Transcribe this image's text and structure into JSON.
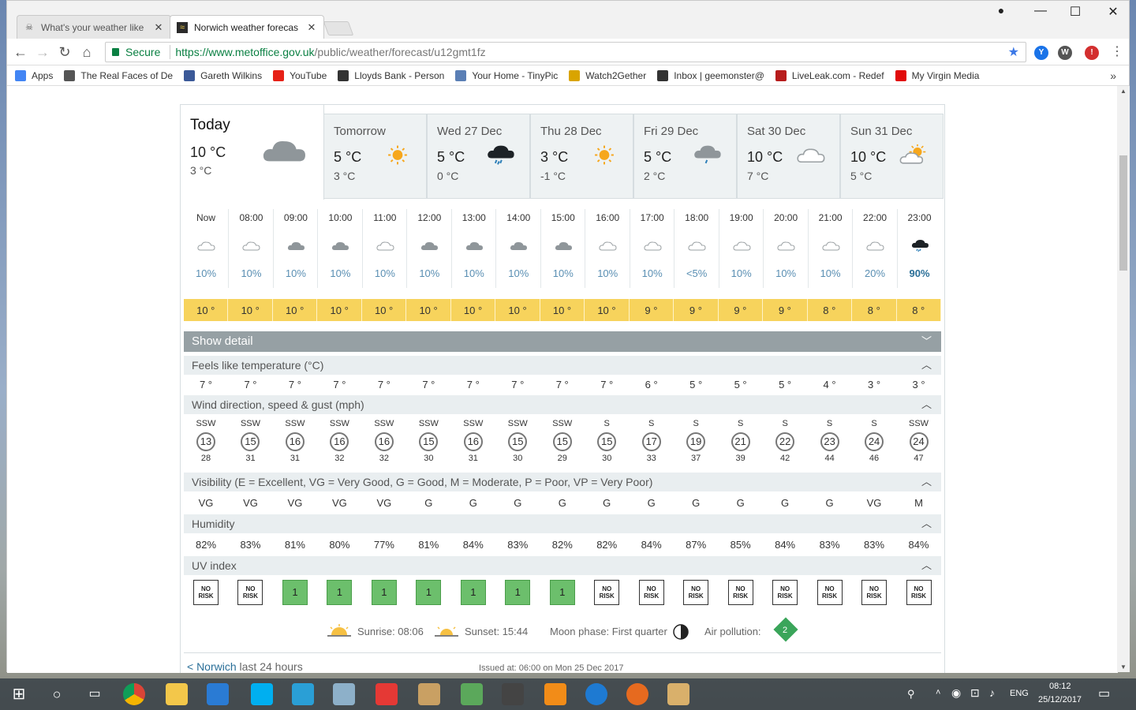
{
  "browser": {
    "tabs": [
      {
        "title": "What's your weather like",
        "active": false
      },
      {
        "title": "Norwich weather forecas",
        "active": true
      }
    ],
    "secure_label": "Secure",
    "url_host": "https://www.metoffice.gov.uk",
    "url_path": "/public/weather/forecast/u12gmt1fz",
    "bookmarks": [
      {
        "label": "Apps",
        "icon": "apps-grid-icon",
        "color": "#4285f4"
      },
      {
        "label": "The Real Faces of De",
        "icon": "skull-icon",
        "color": "#555555"
      },
      {
        "label": "Gareth Wilkins",
        "icon": "facebook-icon",
        "color": "#3b5998"
      },
      {
        "label": "YouTube",
        "icon": "youtube-icon",
        "color": "#e62117"
      },
      {
        "label": "Lloyds Bank - Person",
        "icon": "horse-icon",
        "color": "#333333"
      },
      {
        "label": "Your Home - TinyPic",
        "icon": "tinypic-icon",
        "color": "#5a7fb5"
      },
      {
        "label": "Watch2Gether",
        "icon": "watch2gether-icon",
        "color": "#d9a400"
      },
      {
        "label": "Inbox | geemonster@",
        "icon": "inbox-icon",
        "color": "#333333"
      },
      {
        "label": "LiveLeak.com - Redef",
        "icon": "liveleak-icon",
        "color": "#b71c1c"
      },
      {
        "label": "My Virgin Media",
        "icon": "virgin-icon",
        "color": "#e10a0a"
      }
    ]
  },
  "forecast": {
    "days": [
      {
        "name": "Today",
        "max": "10 °C",
        "min": "3 °C",
        "icon": "cloudy-icon"
      },
      {
        "name": "Tomorrow",
        "max": "5 °C",
        "min": "3 °C",
        "icon": "sunny-icon"
      },
      {
        "name": "Wed 27 Dec",
        "max": "5 °C",
        "min": "0 °C",
        "icon": "heavy-rain-icon"
      },
      {
        "name": "Thu 28 Dec",
        "max": "3 °C",
        "min": "-1 °C",
        "icon": "sunny-icon"
      },
      {
        "name": "Fri 29 Dec",
        "max": "5 °C",
        "min": "2 °C",
        "icon": "light-rain-icon"
      },
      {
        "name": "Sat 30 Dec",
        "max": "10 °C",
        "min": "7 °C",
        "icon": "cloud-outline-icon"
      },
      {
        "name": "Sun 31 Dec",
        "max": "10 °C",
        "min": "5 °C",
        "icon": "sunny-intervals-icon"
      }
    ],
    "hours": [
      "Now",
      "08:00",
      "09:00",
      "10:00",
      "11:00",
      "12:00",
      "13:00",
      "14:00",
      "15:00",
      "16:00",
      "17:00",
      "18:00",
      "19:00",
      "20:00",
      "21:00",
      "22:00",
      "23:00"
    ],
    "hour_icons": [
      "cloud-outline-icon",
      "cloud-outline-icon",
      "cloudy-icon",
      "cloudy-icon",
      "cloud-outline-icon",
      "cloudy-icon",
      "cloudy-icon",
      "cloudy-icon",
      "cloudy-icon",
      "cloud-outline-icon",
      "cloud-outline-icon",
      "cloud-outline-icon",
      "cloud-outline-icon",
      "cloud-outline-icon",
      "cloud-outline-icon",
      "cloud-outline-icon",
      "heavy-rain-icon"
    ],
    "precip": [
      "10%",
      "10%",
      "10%",
      "10%",
      "10%",
      "10%",
      "10%",
      "10%",
      "10%",
      "10%",
      "10%",
      "<5%",
      "10%",
      "10%",
      "10%",
      "20%",
      "90%"
    ],
    "temps": [
      "10 °",
      "10 °",
      "10 °",
      "10 °",
      "10 °",
      "10 °",
      "10 °",
      "10 °",
      "10 °",
      "10 °",
      "9 °",
      "9 °",
      "9 °",
      "9 °",
      "8 °",
      "8 °",
      "8 °"
    ],
    "show_detail": "Show detail",
    "feels_like": {
      "title": "Feels like temperature (°C)",
      "values": [
        "7 °",
        "7 °",
        "7 °",
        "7 °",
        "7 °",
        "7 °",
        "7 °",
        "7 °",
        "7 °",
        "7 °",
        "6 °",
        "5 °",
        "5 °",
        "5 °",
        "4 °",
        "3 °",
        "3 °"
      ]
    },
    "wind": {
      "title": "Wind direction, speed & gust (mph)",
      "directions": [
        "SSW",
        "SSW",
        "SSW",
        "SSW",
        "SSW",
        "SSW",
        "SSW",
        "SSW",
        "SSW",
        "S",
        "S",
        "S",
        "S",
        "S",
        "S",
        "S",
        "SSW"
      ],
      "speeds": [
        "13",
        "15",
        "16",
        "16",
        "16",
        "15",
        "16",
        "15",
        "15",
        "15",
        "17",
        "19",
        "21",
        "22",
        "23",
        "24",
        "24"
      ],
      "gusts": [
        "28",
        "31",
        "31",
        "32",
        "32",
        "30",
        "31",
        "30",
        "29",
        "30",
        "33",
        "37",
        "39",
        "42",
        "44",
        "46",
        "47"
      ]
    },
    "visibility": {
      "title": "Visibility (E = Excellent, VG = Very Good, G = Good, M = Moderate, P = Poor, VP = Very Poor)",
      "values": [
        "VG",
        "VG",
        "VG",
        "VG",
        "VG",
        "G",
        "G",
        "G",
        "G",
        "G",
        "G",
        "G",
        "G",
        "G",
        "G",
        "VG",
        "M"
      ]
    },
    "humidity": {
      "title": "Humidity",
      "values": [
        "82%",
        "83%",
        "81%",
        "80%",
        "77%",
        "81%",
        "84%",
        "83%",
        "82%",
        "82%",
        "84%",
        "87%",
        "85%",
        "84%",
        "83%",
        "83%",
        "84%"
      ]
    },
    "uv": {
      "title": "UV index",
      "values": [
        "NO RISK",
        "NO RISK",
        "1",
        "1",
        "1",
        "1",
        "1",
        "1",
        "1",
        "NO RISK",
        "NO RISK",
        "NO RISK",
        "NO RISK",
        "NO RISK",
        "NO RISK",
        "NO RISK",
        "NO RISK"
      ]
    },
    "sunrise": "Sunrise: 08:06",
    "sunset": "Sunset: 15:44",
    "moon_phase": "Moon phase: First quarter",
    "air_pollution_label": "Air pollution:",
    "air_pollution_value": "2",
    "footer_link": "< Norwich",
    "footer_rest": " last 24 hours",
    "issued": "Issued at: 06:00 on Mon 25 Dec 2017"
  },
  "taskbar": {
    "language": "ENG",
    "time": "08:12",
    "date": "25/12/2017"
  }
}
